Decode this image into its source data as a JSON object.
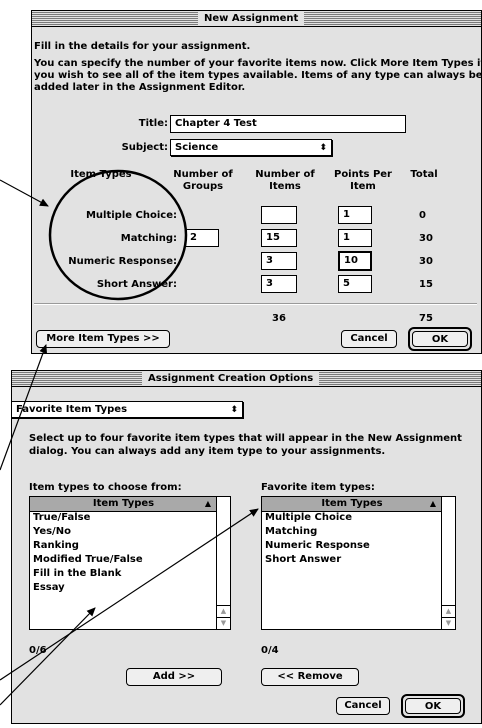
{
  "new_assignment": {
    "title": "New Assignment",
    "intro1": "Fill in the details for your assignment.",
    "intro2": "You can specify the number of your favorite items now.  Click More Item Types if",
    "intro3": "you wish to see all of the item types available.  Items of any type can always be",
    "intro4": "added later in the Assignment Editor.",
    "title_label": "Title:",
    "title_value": "Chapter 4 Test",
    "subject_label": "Subject:",
    "subject_value": "Science",
    "col_item_types": "Item Types",
    "col_groups_1": "Number of",
    "col_groups_2": "Groups",
    "col_items_1": "Number of",
    "col_items_2": "Items",
    "col_points_1": "Points Per",
    "col_points_2": "Item",
    "col_total": "Total",
    "rows": [
      {
        "label": "Multiple Choice:",
        "groups": "",
        "items": "",
        "points": "1",
        "total": "0"
      },
      {
        "label": "Matching:",
        "groups": "2",
        "items": "15",
        "points": "1",
        "total": "30"
      },
      {
        "label": "Numeric Response:",
        "groups": "",
        "items": "3",
        "points": "10",
        "total": "30"
      },
      {
        "label": "Short Answer:",
        "groups": "",
        "items": "3",
        "points": "5",
        "total": "15"
      }
    ],
    "sum_items": "36",
    "sum_total": "75",
    "more_button": "More Item Types >>",
    "cancel_button": "Cancel",
    "ok_button": "OK"
  },
  "options": {
    "title": "Assignment Creation Options",
    "popup_value": "Favorite Item Types",
    "desc1": "Select up to four favorite item types that will appear in the New Assignment",
    "desc2": "dialog. You can always add any item type to your assignments.",
    "choose_label": "Item types to choose from:",
    "favorite_label": "Favorite item types:",
    "list_header": "Item Types",
    "choose_items": [
      "True/False",
      "Yes/No",
      "Ranking",
      "Modified True/False",
      "Fill in the Blank",
      "Essay"
    ],
    "favorite_items": [
      "Multiple Choice",
      "Matching",
      "Numeric Response",
      "Short Answer"
    ],
    "choose_count": "0/6",
    "favorite_count": "0/4",
    "add_button": "Add >>",
    "remove_button": "<< Remove",
    "cancel_button": "Cancel",
    "ok_button": "OK"
  }
}
